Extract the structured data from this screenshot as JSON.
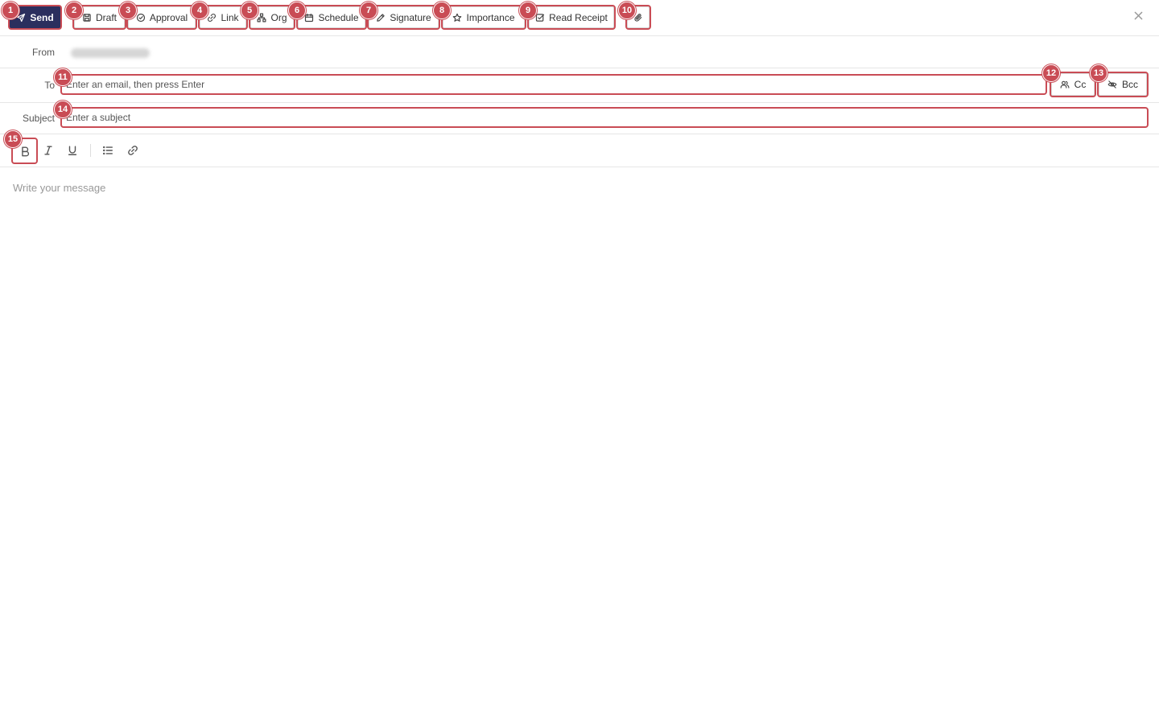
{
  "toolbar": {
    "send_label": "Send",
    "draft_label": "Draft",
    "approval_label": "Approval",
    "link_label": "Link",
    "org_label": "Org",
    "schedule_label": "Schedule",
    "signature_label": "Signature",
    "importance_label": "Importance",
    "read_receipt_label": "Read Receipt",
    "attach_icon": "paperclip-icon",
    "close_icon": "close-icon"
  },
  "from": {
    "label": "From",
    "value": "sender@mail.com"
  },
  "to": {
    "label": "To",
    "placeholder": "Enter an email, then press Enter",
    "cc_label": "Cc",
    "bcc_label": "Bcc"
  },
  "subject": {
    "label": "Subject",
    "placeholder": "Enter a subject"
  },
  "format_toolbar": [
    "bold",
    "italic",
    "underline",
    "bulleted-list",
    "link"
  ],
  "editor": {
    "placeholder": "Write your message"
  },
  "badges": [
    "1",
    "2",
    "3",
    "4",
    "5",
    "6",
    "7",
    "8",
    "9",
    "10",
    "11",
    "12",
    "13",
    "14",
    "15"
  ],
  "colors": {
    "primary": "#2b2f5e",
    "highlight": "#c94c55"
  }
}
